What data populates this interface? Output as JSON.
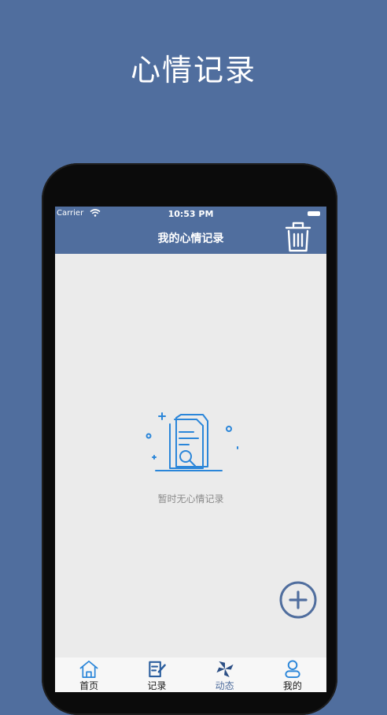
{
  "promo": {
    "title": "心情记录"
  },
  "status_bar": {
    "carrier": "Carrier",
    "time": "10:53 PM"
  },
  "nav": {
    "title": "我的心情记录"
  },
  "empty_state": {
    "message": "暂时无心情记录"
  },
  "tabs": [
    {
      "label": "首页",
      "icon": "home-icon"
    },
    {
      "label": "记录",
      "icon": "edit-note-icon"
    },
    {
      "label": "动态",
      "icon": "pinwheel-icon",
      "active": true
    },
    {
      "label": "我的",
      "icon": "person-icon"
    }
  ],
  "colors": {
    "brand": "#506e9e",
    "icon_blue": "#2b86d9",
    "screen_bg": "#ebebeb"
  }
}
